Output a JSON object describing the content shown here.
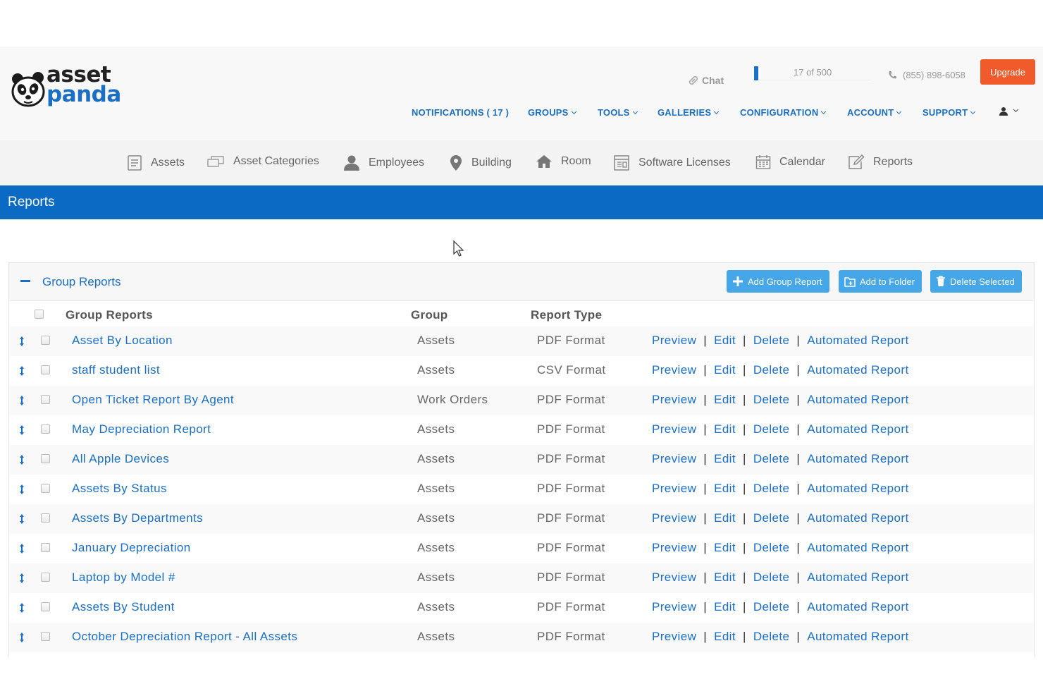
{
  "logo": {
    "line1": "asset",
    "line2": "panda"
  },
  "header": {
    "chat_label": "Chat",
    "usage": {
      "text": "17 of 500",
      "fraction": 0.034
    },
    "phone": "(855) 898-6058",
    "upgrade_label": "Upgrade"
  },
  "topnav": {
    "notifications": "NOTIFICATIONS ( 17 )",
    "groups": "GROUPS",
    "tools": "TOOLS",
    "galleries": "GALLERIES",
    "configuration": "CONFIGURATION",
    "account": "ACCOUNT",
    "support": "SUPPORT"
  },
  "modules": {
    "assets": "Assets",
    "asset_categories": "Asset Categories",
    "employees": "Employees",
    "building": "Building",
    "room": "Room",
    "software_licenses": "Software Licenses",
    "calendar": "Calendar",
    "reports": "Reports"
  },
  "page": {
    "title": "Reports"
  },
  "panel": {
    "title": "Group Reports",
    "buttons": {
      "add_group_report": "Add Group Report",
      "add_to_folder": "Add to Folder",
      "delete_selected": "Delete Selected"
    },
    "columns": {
      "name": "Group Reports",
      "group": "Group",
      "type": "Report Type"
    },
    "actions": {
      "preview": "Preview",
      "edit": "Edit",
      "delete": "Delete",
      "automated": "Automated Report",
      "separator": "|"
    },
    "rows": [
      {
        "name": "Asset By Location",
        "group": "Assets",
        "type": "PDF Format"
      },
      {
        "name": "staff student list",
        "group": "Assets",
        "type": "CSV Format"
      },
      {
        "name": "Open Ticket Report By Agent",
        "group": "Work Orders",
        "type": "PDF Format"
      },
      {
        "name": "May Depreciation Report",
        "group": "Assets",
        "type": "PDF Format"
      },
      {
        "name": "All Apple Devices",
        "group": "Assets",
        "type": "PDF Format"
      },
      {
        "name": "Assets By Status",
        "group": "Assets",
        "type": "PDF Format"
      },
      {
        "name": "Assets By Departments",
        "group": "Assets",
        "type": "PDF Format"
      },
      {
        "name": "January Depreciation",
        "group": "Assets",
        "type": "PDF Format"
      },
      {
        "name": "Laptop by Model #",
        "group": "Assets",
        "type": "PDF Format"
      },
      {
        "name": "Assets By Student",
        "group": "Assets",
        "type": "PDF Format"
      },
      {
        "name": "October Depreciation Report - All Assets",
        "group": "Assets",
        "type": "PDF Format"
      }
    ]
  },
  "colors": {
    "brand_blue": "#0a6ac4",
    "link_blue": "#1a6fc4",
    "button_blue": "#45a7e8",
    "upgrade_orange": "#f15a2b"
  }
}
